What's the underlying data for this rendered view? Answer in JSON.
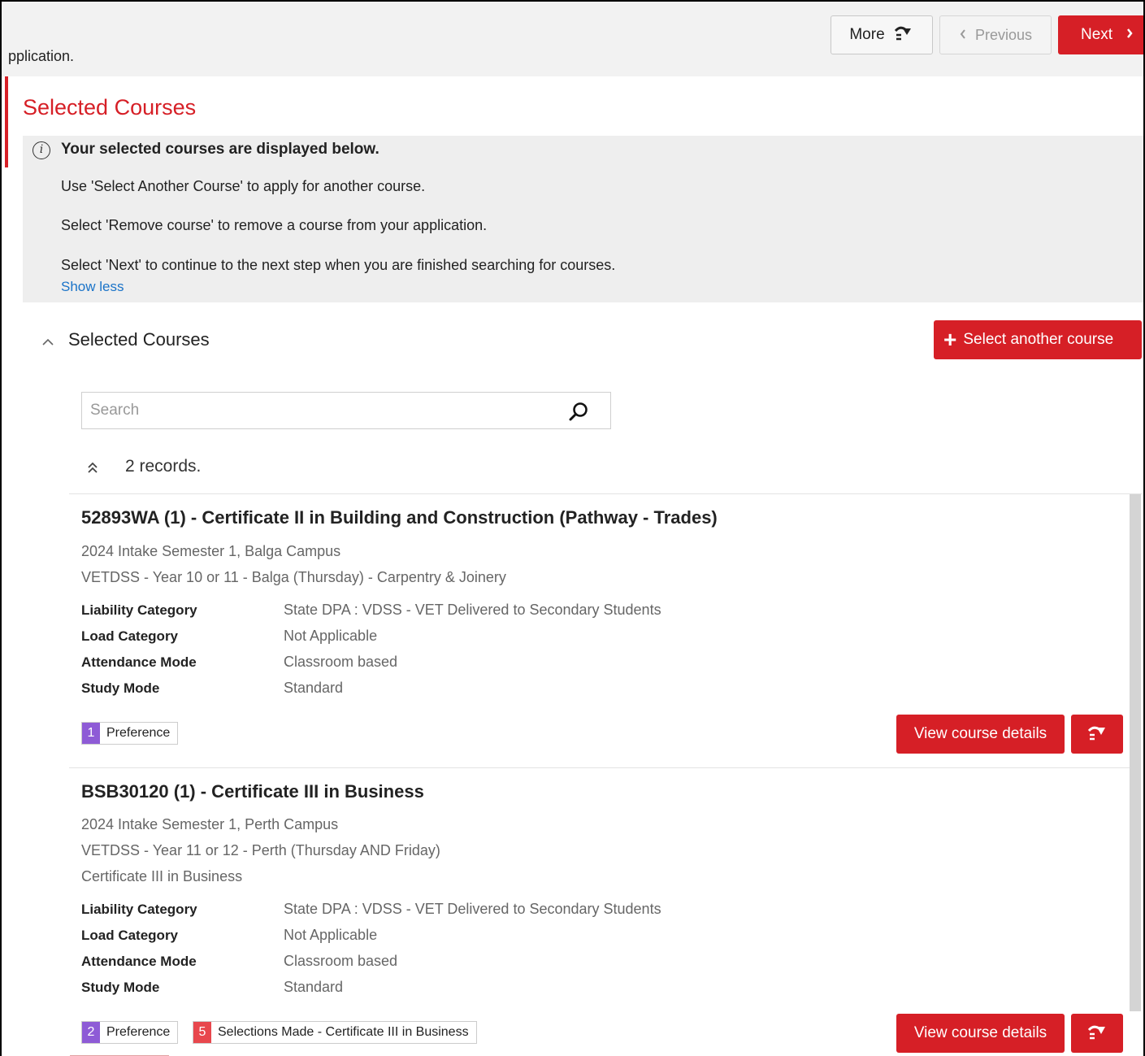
{
  "header": {
    "partial_text": "pplication.",
    "more_label": "More",
    "previous_label": "Previous",
    "next_label": "Next"
  },
  "page": {
    "section_title": "Selected Courses"
  },
  "info": {
    "heading": "Your selected courses are displayed below.",
    "lines": [
      "Use 'Select Another Course' to apply for another course.",
      "Select 'Remove course' to remove a course from your application.",
      "Select 'Next' to continue to the next step when you are finished searching for courses."
    ],
    "toggle_link": "Show less"
  },
  "courses_panel": {
    "title": "Selected Courses",
    "select_another_label": "Select another course",
    "search_placeholder": "Search",
    "records_text": "2 records."
  },
  "courses": [
    {
      "title": "52893WA (1) - Certificate II in Building and Construction (Pathway - Trades)",
      "details": [
        "2024 Intake Semester 1, Balga Campus",
        "VETDSS - Year 10 or 11 - Balga (Thursday) - Carpentry & Joinery"
      ],
      "fields": [
        {
          "label": "Liability Category",
          "value": "State DPA : VDSS - VET Delivered to Secondary Students"
        },
        {
          "label": "Load Category",
          "value": "Not Applicable"
        },
        {
          "label": "Attendance Mode",
          "value": "Classroom based"
        },
        {
          "label": "Study Mode",
          "value": "Standard"
        }
      ],
      "badges": [
        {
          "number": "1",
          "text": "Preference",
          "color": "#8e5bd6"
        }
      ],
      "view_label": "View course details"
    },
    {
      "title": "BSB30120 (1) - Certificate III in Business",
      "details": [
        "2024 Intake Semester 1, Perth Campus",
        "VETDSS - Year 11 or 12 - Perth (Thursday AND Friday)",
        "Certificate III in Business"
      ],
      "fields": [
        {
          "label": "Liability Category",
          "value": "State DPA : VDSS - VET Delivered to Secondary Students"
        },
        {
          "label": "Load Category",
          "value": "Not Applicable"
        },
        {
          "label": "Attendance Mode",
          "value": "Classroom based"
        },
        {
          "label": "Study Mode",
          "value": "Standard"
        }
      ],
      "badges": [
        {
          "number": "2",
          "text": "Preference",
          "color": "#8e5bd6"
        },
        {
          "number": "5",
          "text": "Selections Made - Certificate III in Business",
          "color": "#e8474d"
        }
      ],
      "view_label": "View course details"
    }
  ],
  "colors": {
    "accent": "#d61f26",
    "link": "#1a73c8",
    "preference_badge": "#8e5bd6",
    "selections_badge": "#e8474d"
  }
}
